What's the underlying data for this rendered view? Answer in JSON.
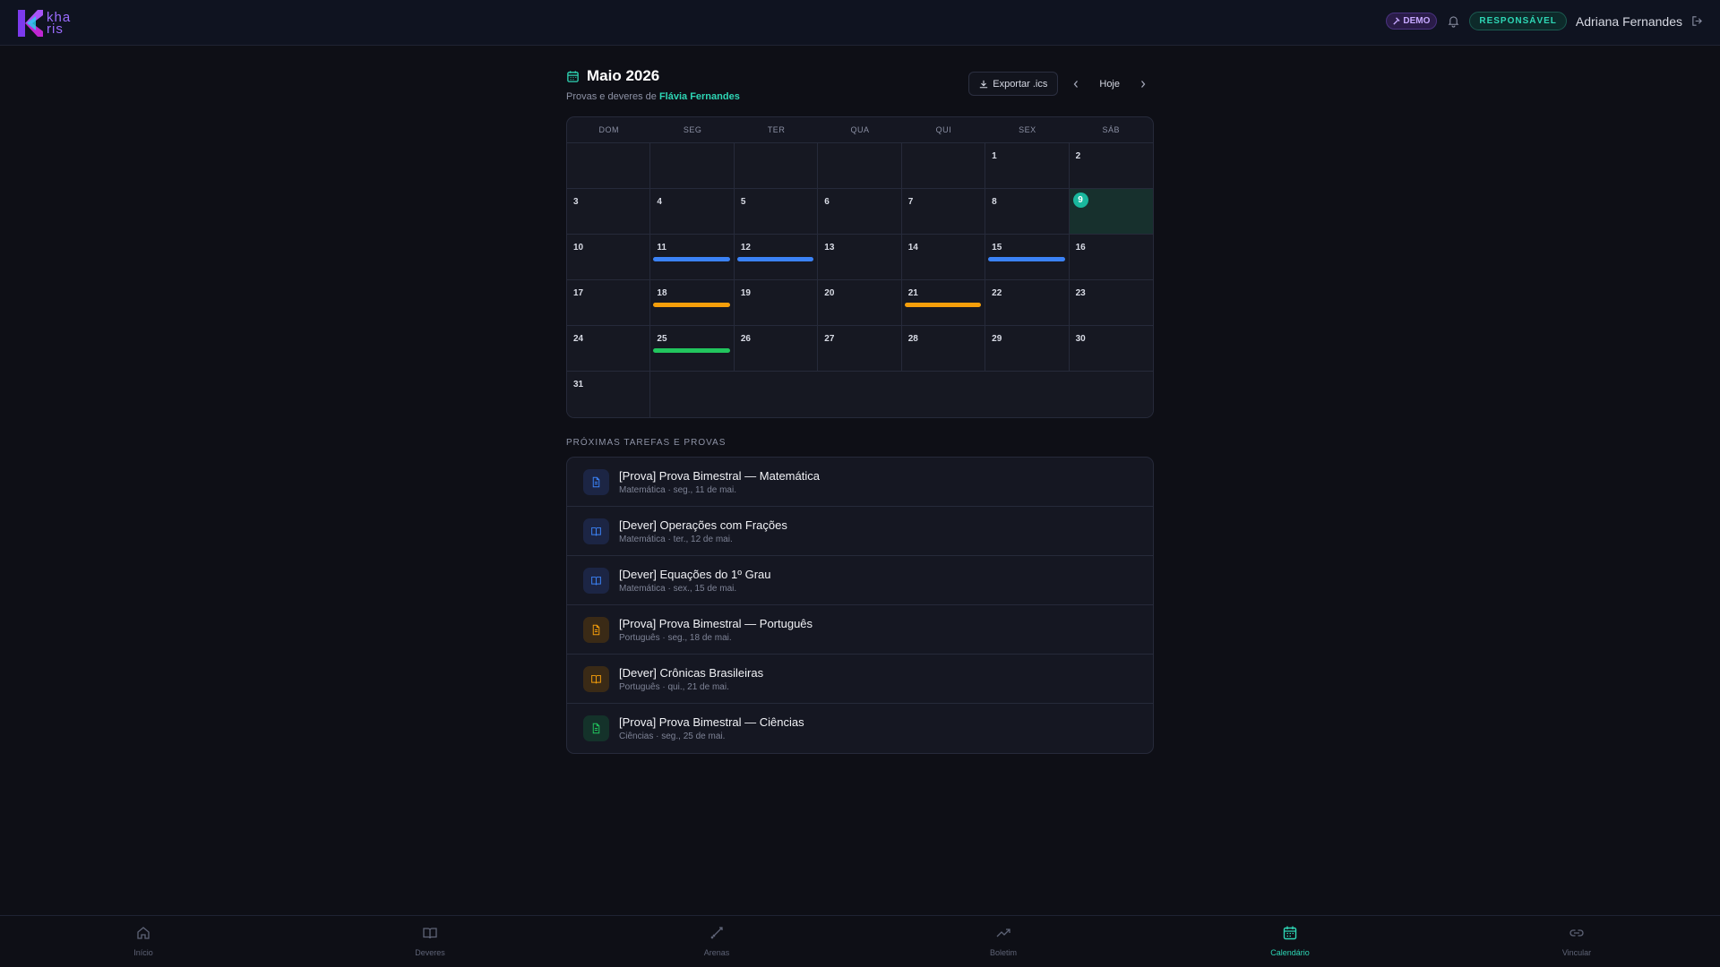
{
  "header": {
    "logo_text": "kha ris",
    "demo_label": "DEMO",
    "role_label": "RESPONSÁVEL",
    "user_name": "Adriana Fernandes"
  },
  "page": {
    "title": "Maio 2026",
    "subtitle_prefix": "Provas e deveres de",
    "student_name": "Flávia Fernandes",
    "export_label": "Exportar .ics",
    "today_label": "Hoje"
  },
  "calendar": {
    "weekdays": [
      "DOM",
      "SEG",
      "TER",
      "QUA",
      "QUI",
      "SEX",
      "SÁB"
    ],
    "today": 9,
    "event_colors": {
      "blue": "#3b82f6",
      "orange": "#f59e0b",
      "green": "#22c55e",
      "teal": "#19b89d"
    },
    "events": [
      {
        "day": 11,
        "color": "blue"
      },
      {
        "day": 12,
        "color": "blue"
      },
      {
        "day": 15,
        "color": "blue"
      },
      {
        "day": 18,
        "color": "orange"
      },
      {
        "day": 21,
        "color": "orange"
      },
      {
        "day": 25,
        "color": "green"
      }
    ]
  },
  "upcoming": {
    "section_label": "PRÓXIMAS TAREFAS E PROVAS",
    "items": [
      {
        "title": "[Prova] Prova Bimestral — Matemática",
        "meta": "Matemática · seg., 11 de mai.",
        "icon": "file-icon",
        "color": "blue"
      },
      {
        "title": "[Dever] Operações com Frações",
        "meta": "Matemática · ter., 12 de mai.",
        "icon": "book-icon",
        "color": "blue"
      },
      {
        "title": "[Dever] Equações do 1º Grau",
        "meta": "Matemática · sex., 15 de mai.",
        "icon": "book-icon",
        "color": "blue"
      },
      {
        "title": "[Prova] Prova Bimestral — Português",
        "meta": "Português · seg., 18 de mai.",
        "icon": "file-icon",
        "color": "orange"
      },
      {
        "title": "[Dever] Crônicas Brasileiras",
        "meta": "Português · qui., 21 de mai.",
        "icon": "book-icon",
        "color": "orange"
      },
      {
        "title": "[Prova] Prova Bimestral — Ciências",
        "meta": "Ciências · seg., 25 de mai.",
        "icon": "file-icon",
        "color": "green"
      }
    ]
  },
  "bottom_nav": [
    {
      "label": "Início",
      "icon": "home-icon"
    },
    {
      "label": "Deveres",
      "icon": "book-icon"
    },
    {
      "label": "Arenas",
      "icon": "swords-icon"
    },
    {
      "label": "Boletim",
      "icon": "trending-up-icon"
    },
    {
      "label": "Calendário",
      "icon": "calendar-icon",
      "active": true
    },
    {
      "label": "Vincular",
      "icon": "link-icon"
    }
  ]
}
